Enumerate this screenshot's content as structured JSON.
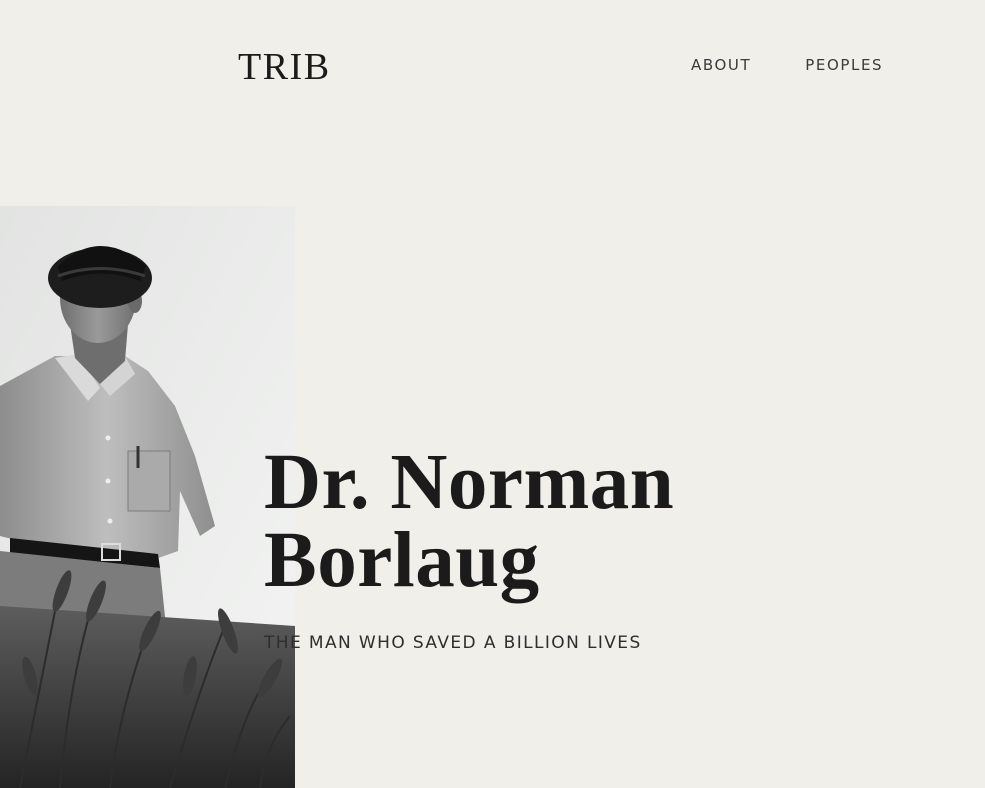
{
  "header": {
    "logo": "TRIB",
    "nav": [
      {
        "label": "ABOUT"
      },
      {
        "label": "PEOPLES"
      }
    ]
  },
  "hero": {
    "title_line1": "Dr. Norman",
    "title_line2": "Borlaug",
    "subtitle": "THE MAN WHO SAVED A BILLION LIVES",
    "photo_alt": "Dr. Norman Borlaug standing in a wheat field",
    "photo_style": "black-and-white"
  },
  "colors": {
    "background": "#f0efea",
    "text": "#1b1b1b"
  }
}
